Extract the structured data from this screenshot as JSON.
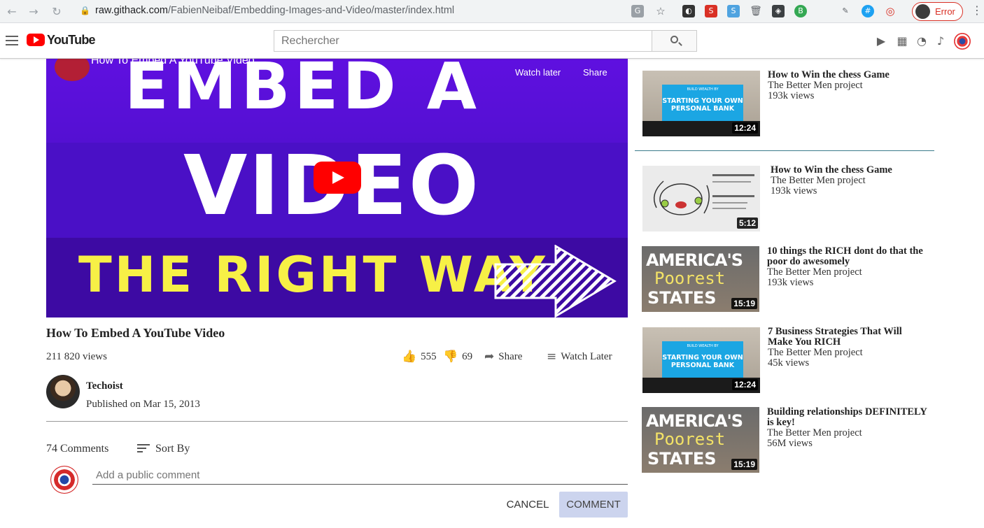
{
  "browser": {
    "url_host": "raw.githack.com",
    "url_path": "/FabienNeibaf/Embedding-Images-and-Video/master/index.html",
    "error_label": "Error"
  },
  "header": {
    "logo_text": "YouTube",
    "search_placeholder": "Rechercher"
  },
  "player": {
    "overlay_title": "How To Embed A YouTube Video",
    "watch_later": "Watch later",
    "share": "Share",
    "line1": "EMBED A",
    "line2": "VIDEO",
    "line3": "THE RIGHT WAY"
  },
  "video": {
    "title": "How To Embed A YouTube Video",
    "views": "211 820 views",
    "likes": "555",
    "dislikes": "69",
    "share_label": "Share",
    "watch_later_label": "Watch Later",
    "channel": "Techoist",
    "published": "Published on Mar 15, 2013"
  },
  "comments": {
    "count": "74 Comments",
    "sort_label": "Sort By",
    "placeholder": "Add a public comment",
    "cancel_label": "CANCEL",
    "comment_label": "COMMENT"
  },
  "related": [
    {
      "title": "How to Win the chess Game",
      "channel": "The Better Men project",
      "views": "193k views",
      "duration": "12:24",
      "thumb": "bank"
    },
    {
      "title": "How to Win the chess Game",
      "channel": "The Better Men project",
      "views": "193k views",
      "duration": "5:12",
      "thumb": "chess"
    },
    {
      "title": "10 things the RICH dont do that the poor do awesomely",
      "channel": "The Better Men project",
      "views": "193k views",
      "duration": "15:19",
      "thumb": "poor"
    },
    {
      "title": "7 Business Strategies That Will Make You RICH",
      "channel": "The Better Men project",
      "views": "45k views",
      "duration": "12:24",
      "thumb": "bank"
    },
    {
      "title": "Building relationships DEFINITELY is key!",
      "channel": "The Better Men project",
      "views": "56M views",
      "duration": "15:19",
      "thumb": "poor"
    }
  ],
  "thumb_text": {
    "bank_small": "BUILD WEALTH BY",
    "bank_big": "STARTING YOUR OWN PERSONAL BANK",
    "poor_1": "AMERICA'S",
    "poor_2": "Poorest",
    "poor_3": "STATES"
  },
  "colors": {
    "youtube_red": "#ff0000",
    "player_purple": "#4a10c6",
    "yellow_text": "#f7f046",
    "comment_button_bg": "#ccd4ee"
  }
}
